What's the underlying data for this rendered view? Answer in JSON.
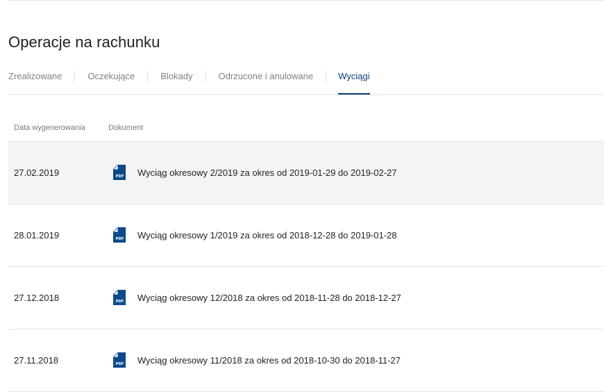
{
  "page": {
    "title": "Operacje na rachunku"
  },
  "tabs": [
    {
      "label": "Zrealizowane",
      "active": false
    },
    {
      "label": "Oczekujące",
      "active": false
    },
    {
      "label": "Blokady",
      "active": false
    },
    {
      "label": "Odrzucone i anulowane",
      "active": false
    },
    {
      "label": "Wyciągi",
      "active": true
    }
  ],
  "table": {
    "headers": {
      "date": "Data wygenerowania",
      "document": "Dokument"
    },
    "rows": [
      {
        "date": "27.02.2019",
        "document": "Wyciąg okresowy 2/2019 za okres od 2019-01-29 do 2019-02-27",
        "icon": "pdf-icon"
      },
      {
        "date": "28.01.2019",
        "document": "Wyciąg okresowy 1/2019 za okres od 2018-12-28 do 2019-01-28",
        "icon": "pdf-icon"
      },
      {
        "date": "27.12.2018",
        "document": "Wyciąg okresowy 12/2018 za okres od 2018-11-28 do 2018-12-27",
        "icon": "pdf-icon"
      },
      {
        "date": "27.11.2018",
        "document": "Wyciąg okresowy 11/2018 za okres od 2018-10-30 do 2018-11-27",
        "icon": "pdf-icon"
      }
    ]
  },
  "icons": {
    "pdf_text": "PDF"
  },
  "colors": {
    "accent": "#0a3f7c",
    "pdf_icon": "#0b4a8b",
    "row_highlight": "#f4f4f4"
  }
}
